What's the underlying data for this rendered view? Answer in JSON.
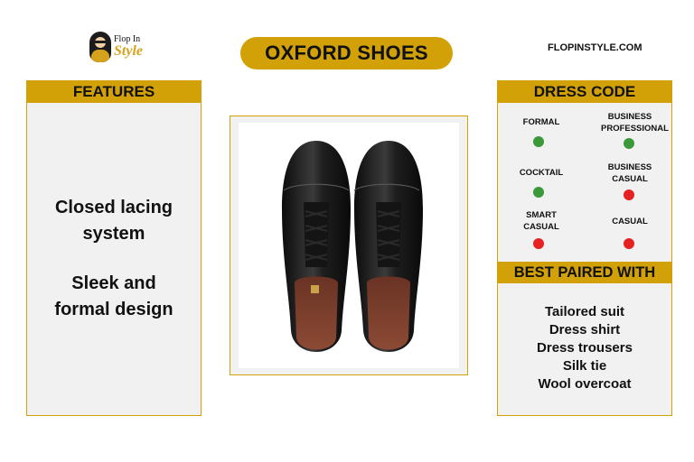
{
  "header": {
    "logo_line1": "Flop In",
    "logo_line2": "Style",
    "title": "OXFORD SHOES",
    "site": "FLOPINSTYLE.COM"
  },
  "features": {
    "heading": "FEATURES",
    "items": [
      "Closed lacing system",
      "Sleek and formal design"
    ]
  },
  "dress_code": {
    "heading": "DRESS CODE",
    "items": [
      {
        "label": "FORMAL",
        "status": "yes",
        "color": "#3a9a3a"
      },
      {
        "label": "BUSINESS PROFESSIONAL",
        "status": "yes",
        "color": "#3a9a3a"
      },
      {
        "label": "COCKTAIL",
        "status": "yes",
        "color": "#3a9a3a"
      },
      {
        "label": "BUSINESS CASUAL",
        "status": "no",
        "color": "#e52121"
      },
      {
        "label": "SMART CASUAL",
        "status": "no",
        "color": "#e52121"
      },
      {
        "label": "CASUAL",
        "status": "no",
        "color": "#e52121"
      }
    ]
  },
  "best_paired": {
    "heading": "BEST PAIRED WITH",
    "items": [
      "Tailored suit",
      "Dress shirt",
      "Dress trousers",
      "Silk tie",
      "Wool overcoat"
    ]
  },
  "colors": {
    "accent": "#d1a107",
    "panel_bg": "#f1f1f1",
    "suitable": "#3a9a3a",
    "not_suitable": "#e52121"
  }
}
